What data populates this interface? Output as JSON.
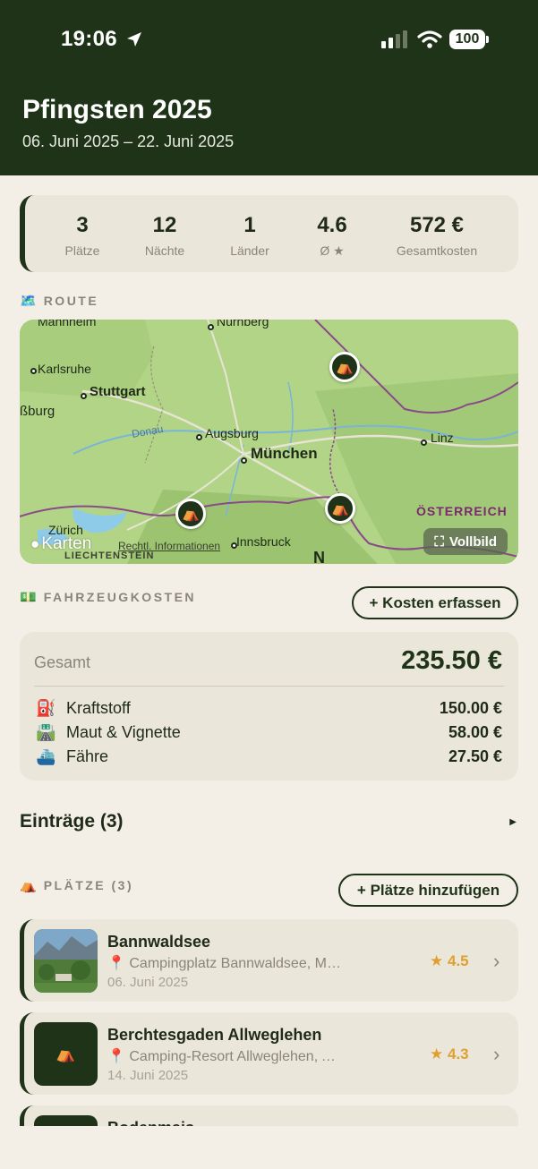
{
  "status_bar": {
    "time": "19:06",
    "battery": "100"
  },
  "trip": {
    "title": "Pfingsten 2025",
    "dates": "06. Juni 2025 – 22. Juni 2025"
  },
  "stats": [
    {
      "value": "3",
      "label": "Plätze"
    },
    {
      "value": "12",
      "label": "Nächte"
    },
    {
      "value": "1",
      "label": "Länder"
    },
    {
      "value": "4.6",
      "label": "Ø ★"
    },
    {
      "value": "572 €",
      "label": "Gesamtkosten"
    }
  ],
  "route": {
    "section_label": "ROUTE",
    "map": {
      "cities": [
        "Mannheim",
        "Nürnberg",
        "Karlsruhe",
        "Stuttgart",
        "ßburg",
        "Donau",
        "Augsburg",
        "München",
        "Linz",
        "Zürich",
        "Innsbruck"
      ],
      "country": "ÖSTERREICH",
      "region": "LIECHTENSTEIN",
      "compass": "N",
      "brand": "Karten",
      "legal": "Rechtl. Informationen",
      "fullscreen_label": "Vollbild"
    }
  },
  "vehicle_costs": {
    "section_label": "FAHRZEUGKOSTEN",
    "add_button": "+ Kosten erfassen",
    "total_label": "Gesamt",
    "total_value": "235.50 €",
    "items": [
      {
        "icon": "fuel-pump-icon",
        "label": "Kraftstoff",
        "amount": "150.00 €"
      },
      {
        "icon": "highway-icon",
        "label": "Maut & Vignette",
        "amount": "58.00 €"
      },
      {
        "icon": "ferry-icon",
        "label": "Fähre",
        "amount": "27.50 €"
      }
    ]
  },
  "entries": {
    "title": "Einträge (3)"
  },
  "places": {
    "section_label": "PLÄTZE (3)",
    "add_button": "+ Plätze hinzufügen",
    "items": [
      {
        "name": "Bannwaldsee",
        "address": "Campingplatz Bannwaldsee, Münchener Straße",
        "date": "06. Juni 2025",
        "rating": "4.5",
        "thumb": "photo"
      },
      {
        "name": "Berchtesgaden Allweglehen",
        "address": "Camping-Resort Allweglehen, Allweggasse, Berchtesgaden",
        "date": "14. Juni 2025",
        "rating": "4.3",
        "thumb": "tent-icon"
      },
      {
        "name": "Bodenmais",
        "address": "",
        "date": "",
        "rating": "",
        "thumb": "tent-icon"
      }
    ]
  },
  "colors": {
    "primary": "#1f3318",
    "background": "#f3efe6",
    "card": "#ebe6da",
    "rating": "#e0a030",
    "muted": "#8a857a"
  }
}
